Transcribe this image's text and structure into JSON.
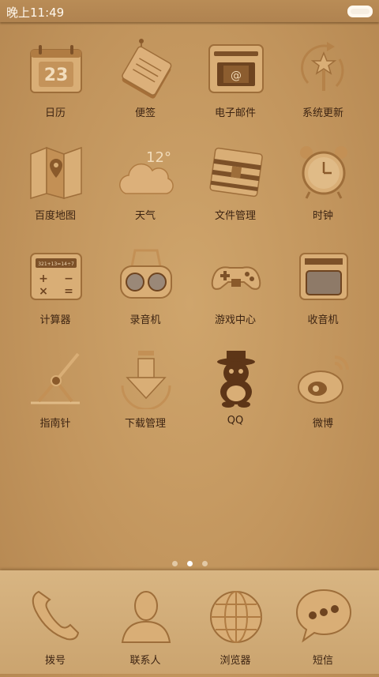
{
  "status_bar": {
    "time": "晚上11:49",
    "battery_icon": "battery-icon"
  },
  "colors": {
    "accent": "#c2955d",
    "icon_fill": "#d9ae76",
    "icon_dark": "#8a5a2b",
    "label": "#3d2412"
  },
  "apps": [
    {
      "label": "日历",
      "icon": "calendar-icon",
      "calendar_day": "23"
    },
    {
      "label": "便签",
      "icon": "notes-icon"
    },
    {
      "label": "电子邮件",
      "icon": "email-icon"
    },
    {
      "label": "系统更新",
      "icon": "system-update-icon"
    },
    {
      "label": "百度地图",
      "icon": "map-icon"
    },
    {
      "label": "天气",
      "icon": "weather-icon",
      "temperature": "12°"
    },
    {
      "label": "文件管理",
      "icon": "file-manager-icon"
    },
    {
      "label": "时钟",
      "icon": "clock-icon"
    },
    {
      "label": "计算器",
      "icon": "calculator-icon",
      "display": "321+13=14÷7"
    },
    {
      "label": "录音机",
      "icon": "recorder-icon"
    },
    {
      "label": "游戏中心",
      "icon": "game-center-icon"
    },
    {
      "label": "收音机",
      "icon": "radio-icon"
    },
    {
      "label": "指南针",
      "icon": "compass-icon"
    },
    {
      "label": "下载管理",
      "icon": "download-manager-icon"
    },
    {
      "label": "QQ",
      "icon": "qq-icon"
    },
    {
      "label": "微博",
      "icon": "weibo-icon"
    }
  ],
  "page_indicator": {
    "pages": 3,
    "current": 2
  },
  "dock": [
    {
      "label": "拨号",
      "icon": "phone-icon"
    },
    {
      "label": "联系人",
      "icon": "contacts-icon"
    },
    {
      "label": "浏览器",
      "icon": "browser-icon"
    },
    {
      "label": "短信",
      "icon": "messages-icon"
    }
  ]
}
